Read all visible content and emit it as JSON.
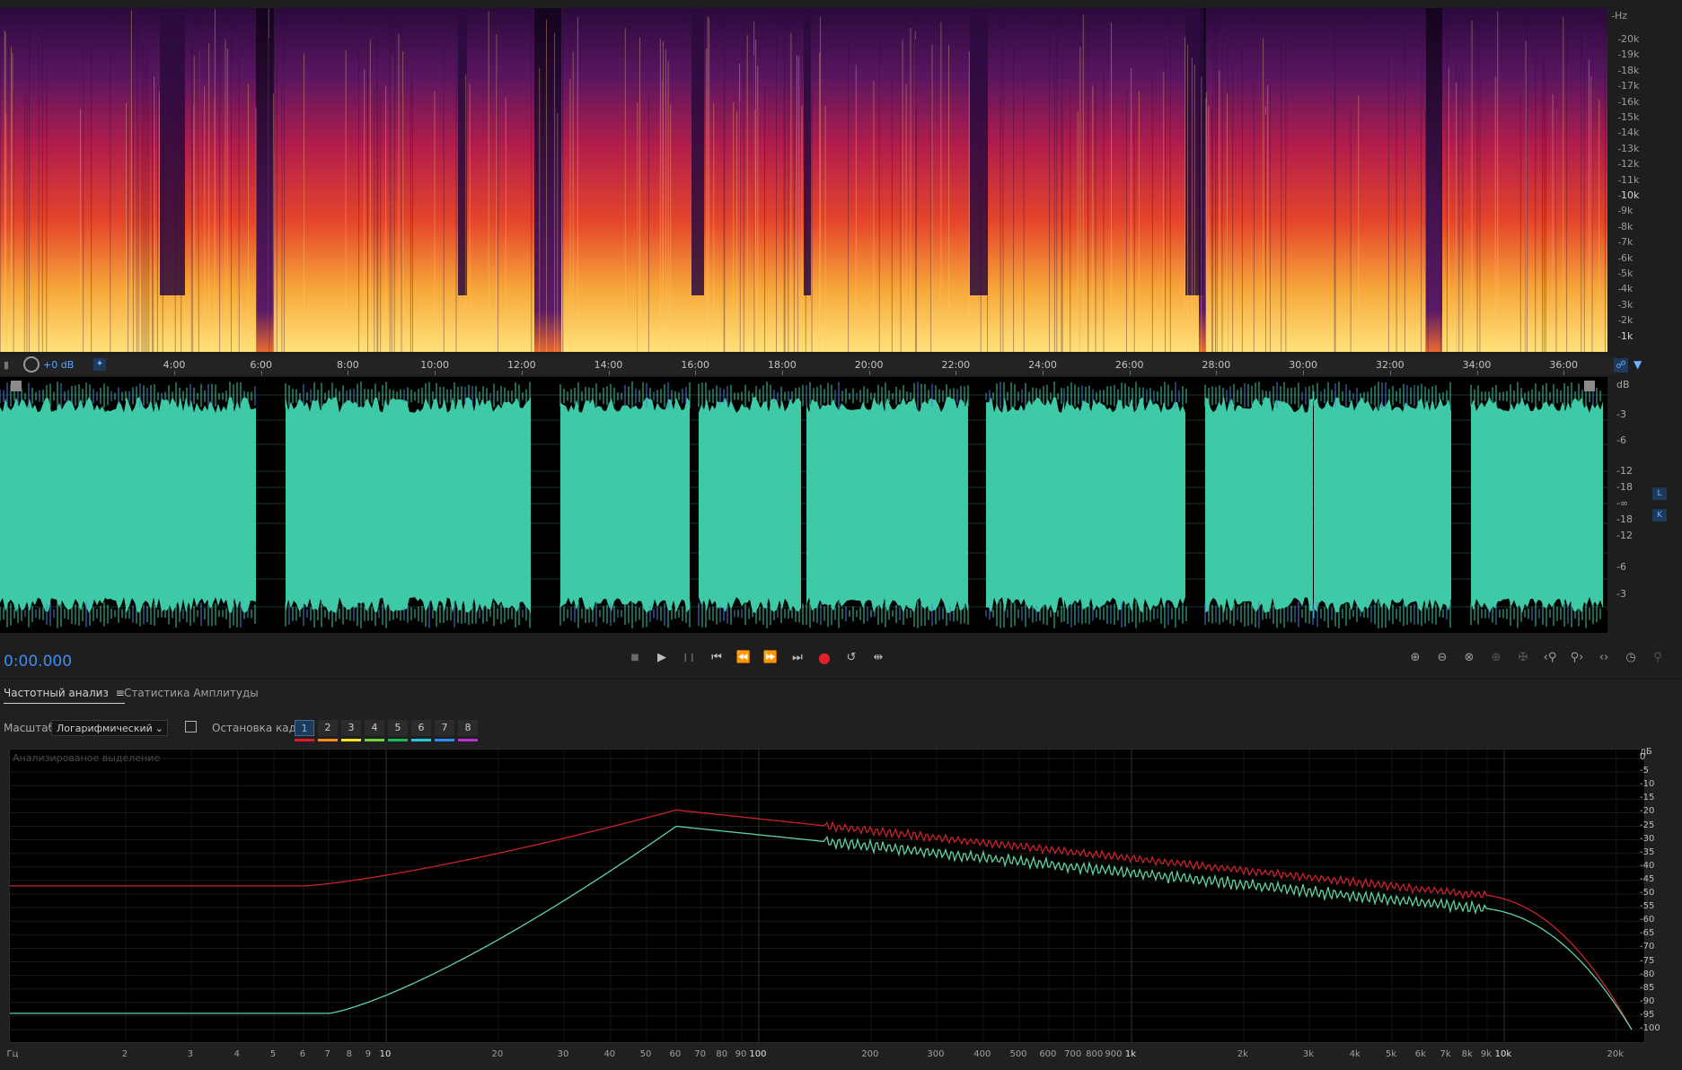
{
  "spectral": {
    "unit_label": "Hz",
    "freq_ticks": [
      "20k",
      "19k",
      "18k",
      "17k",
      "16k",
      "15k",
      "14k",
      "13k",
      "12k",
      "11k",
      "10k",
      "9k",
      "8k",
      "7k",
      "6k",
      "5k",
      "4k",
      "3k",
      "2k",
      "1k"
    ]
  },
  "timeline": {
    "volume_label": "+0 dB",
    "labels": [
      "4:00",
      "6:00",
      "8:00",
      "10:00",
      "12:00",
      "14:00",
      "16:00",
      "18:00",
      "20:00",
      "22:00",
      "24:00",
      "26:00",
      "28:00",
      "30:00",
      "32:00",
      "34:00",
      "36:00"
    ]
  },
  "waveform": {
    "unit_label": "dB",
    "db_ticks_top": [
      "-3",
      "-6",
      "-12",
      "-18"
    ],
    "inf_label": "-∞",
    "db_ticks_bottom": [
      "-18",
      "-12",
      "-6",
      "-3"
    ],
    "channel_top": "L",
    "channel_bottom": "K"
  },
  "transport": {
    "time_display": "0:00.000",
    "buttons": {
      "stop": "■",
      "play": "▶",
      "pause": "❙❙",
      "to_start": "⏮",
      "rewind": "⏪",
      "forward": "⏩",
      "to_end": "⏭",
      "record": "●",
      "loop": "↺",
      "skip": "⇹"
    }
  },
  "analysis": {
    "tabs": [
      "Частотный анализ",
      "Статистика Амплитуды"
    ],
    "menu_icon": "≡",
    "scale_label": "Масштаб:",
    "scale_value": "Логарифмический",
    "hold_label": "Остановка кадра:",
    "frames": [
      "1",
      "2",
      "3",
      "4",
      "5",
      "6",
      "7",
      "8"
    ],
    "frame_colors": [
      "#e0192b",
      "#ff8a1a",
      "#f7e12b",
      "#6fd43c",
      "#1fbb5b",
      "#29c8d8",
      "#2a8cff",
      "#c02bd6"
    ],
    "plot_caption": "Анализированое выделение",
    "db_unit": "дБ",
    "db_ticks": [
      "0",
      "-5",
      "-10",
      "-15",
      "-20",
      "-25",
      "-30",
      "-35",
      "-40",
      "-45",
      "-50",
      "-55",
      "-60",
      "-65",
      "-70",
      "-75",
      "-80",
      "-85",
      "-90",
      "-95",
      "-100"
    ],
    "freq_unit": "Гц",
    "freq_ticks": [
      "2",
      "3",
      "4",
      "5",
      "6",
      "7",
      "8",
      "9",
      "10",
      "20",
      "30",
      "40",
      "50",
      "60",
      "70",
      "80",
      "90",
      "100",
      "200",
      "300",
      "400",
      "500",
      "600",
      "700",
      "800",
      "900",
      "1k",
      "2k",
      "3k",
      "4k",
      "5k",
      "6k",
      "7k",
      "8k",
      "9k",
      "10k",
      "20k"
    ],
    "major_freqs": [
      "10",
      "100",
      "1k",
      "10k"
    ]
  },
  "colors": {
    "waveform_fill": "#3ecaa6",
    "waveform_peak": "#4b7fd9",
    "curve_red": "#c8232c",
    "curve_green": "#5fd3a0",
    "accent": "#3d8df2"
  }
}
